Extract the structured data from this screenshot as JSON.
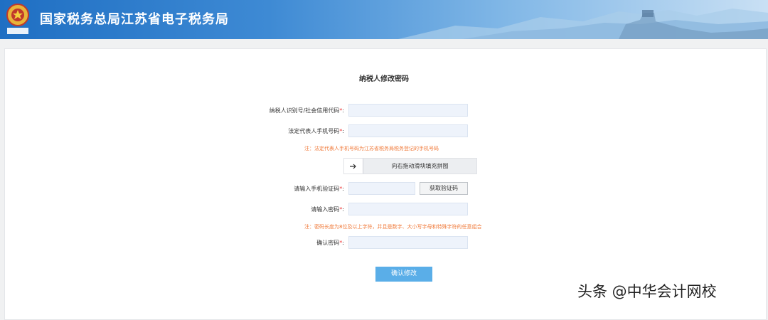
{
  "header": {
    "title": "国家税务总局江苏省电子税务局",
    "emblem_text": "中国税务",
    "background": "#2a77c9"
  },
  "form": {
    "title": "纳税人修改密码",
    "required_mark": "*",
    "colon": ":",
    "fields": {
      "taxpayer_id": {
        "label": "纳税人识别号/社会信用代码",
        "value": ""
      },
      "phone": {
        "label": "法定代表人手机号码",
        "value": ""
      },
      "sms_code": {
        "label": "请输入手机验证码",
        "value": ""
      },
      "password": {
        "label": "请输入密码",
        "value": ""
      },
      "confirm_password": {
        "label": "确认密码",
        "value": ""
      }
    },
    "notes": {
      "phone": "注：法定代表人手机号码为江苏省税务局税务登记的手机号码",
      "password": "注：密码长度为8位及以上字符，并且是数字、大小写字母和特殊字符的任意组合"
    },
    "slider": {
      "text": "向右拖动滑块填充拼图",
      "icon": "arrow-right-icon"
    },
    "get_code_button": "获取验证码",
    "submit_button": "确认修改"
  },
  "watermark": "头条 @中华会计网校",
  "colors": {
    "accent": "#5aaee8",
    "note": "#f07a3a",
    "required": "#e33333",
    "input_bg": "#eef3fb"
  }
}
